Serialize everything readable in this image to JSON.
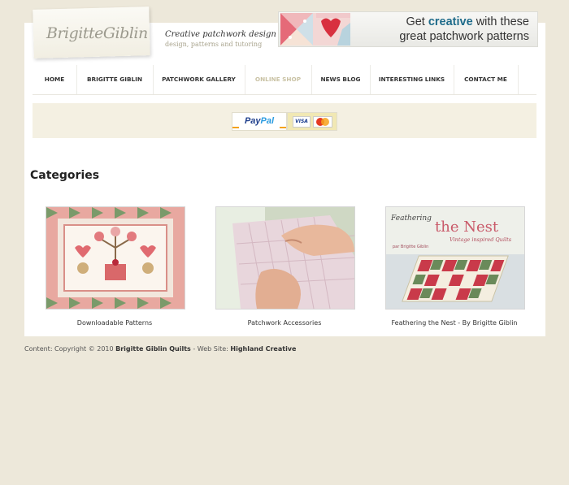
{
  "header": {
    "logo_text": "BrigitteGiblin",
    "tagline": "Creative patchwork design",
    "tagline_sub": "design, patterns and tutoring"
  },
  "banner": {
    "line1_pre": "Get ",
    "line1_highlight": "creative",
    "line1_post": " with these",
    "line2": "great patchwork patterns"
  },
  "nav": {
    "items": [
      {
        "label": "HOME",
        "active": false
      },
      {
        "label": "BRIGITTE GIBLIN",
        "active": false
      },
      {
        "label": "PATCHWORK GALLERY",
        "active": false
      },
      {
        "label": "ONLINE SHOP",
        "active": true
      },
      {
        "label": "NEWS BLOG",
        "active": false
      },
      {
        "label": "INTERESTING LINKS",
        "active": false
      },
      {
        "label": "CONTACT ME",
        "active": false
      }
    ]
  },
  "payment": {
    "paypal_a": "Pay",
    "paypal_b": "Pal",
    "visa": "VISA"
  },
  "main": {
    "heading": "Categories",
    "categories": [
      {
        "caption": "Downloadable Patterns"
      },
      {
        "caption": "Patchwork Accessories"
      },
      {
        "caption": "Feathering the Nest - By Brigitte Giblin"
      }
    ],
    "book_title_a": "Feathering",
    "book_title_b": "the Nest",
    "book_subtitle": "Vintage inspired Quilts",
    "book_author": "par Brigitte Giblin"
  },
  "footer": {
    "prefix": "Content: Copyright © 2010 ",
    "owner": "Brigitte Giblin Quilts",
    "middle": " - Web Site: ",
    "designer": "Highland Creative"
  },
  "colors": {
    "background": "#ede8da",
    "paybar": "#f4f0e2",
    "nav_active": "#c9c2a4",
    "banner_highlight": "#1e6b8a"
  }
}
